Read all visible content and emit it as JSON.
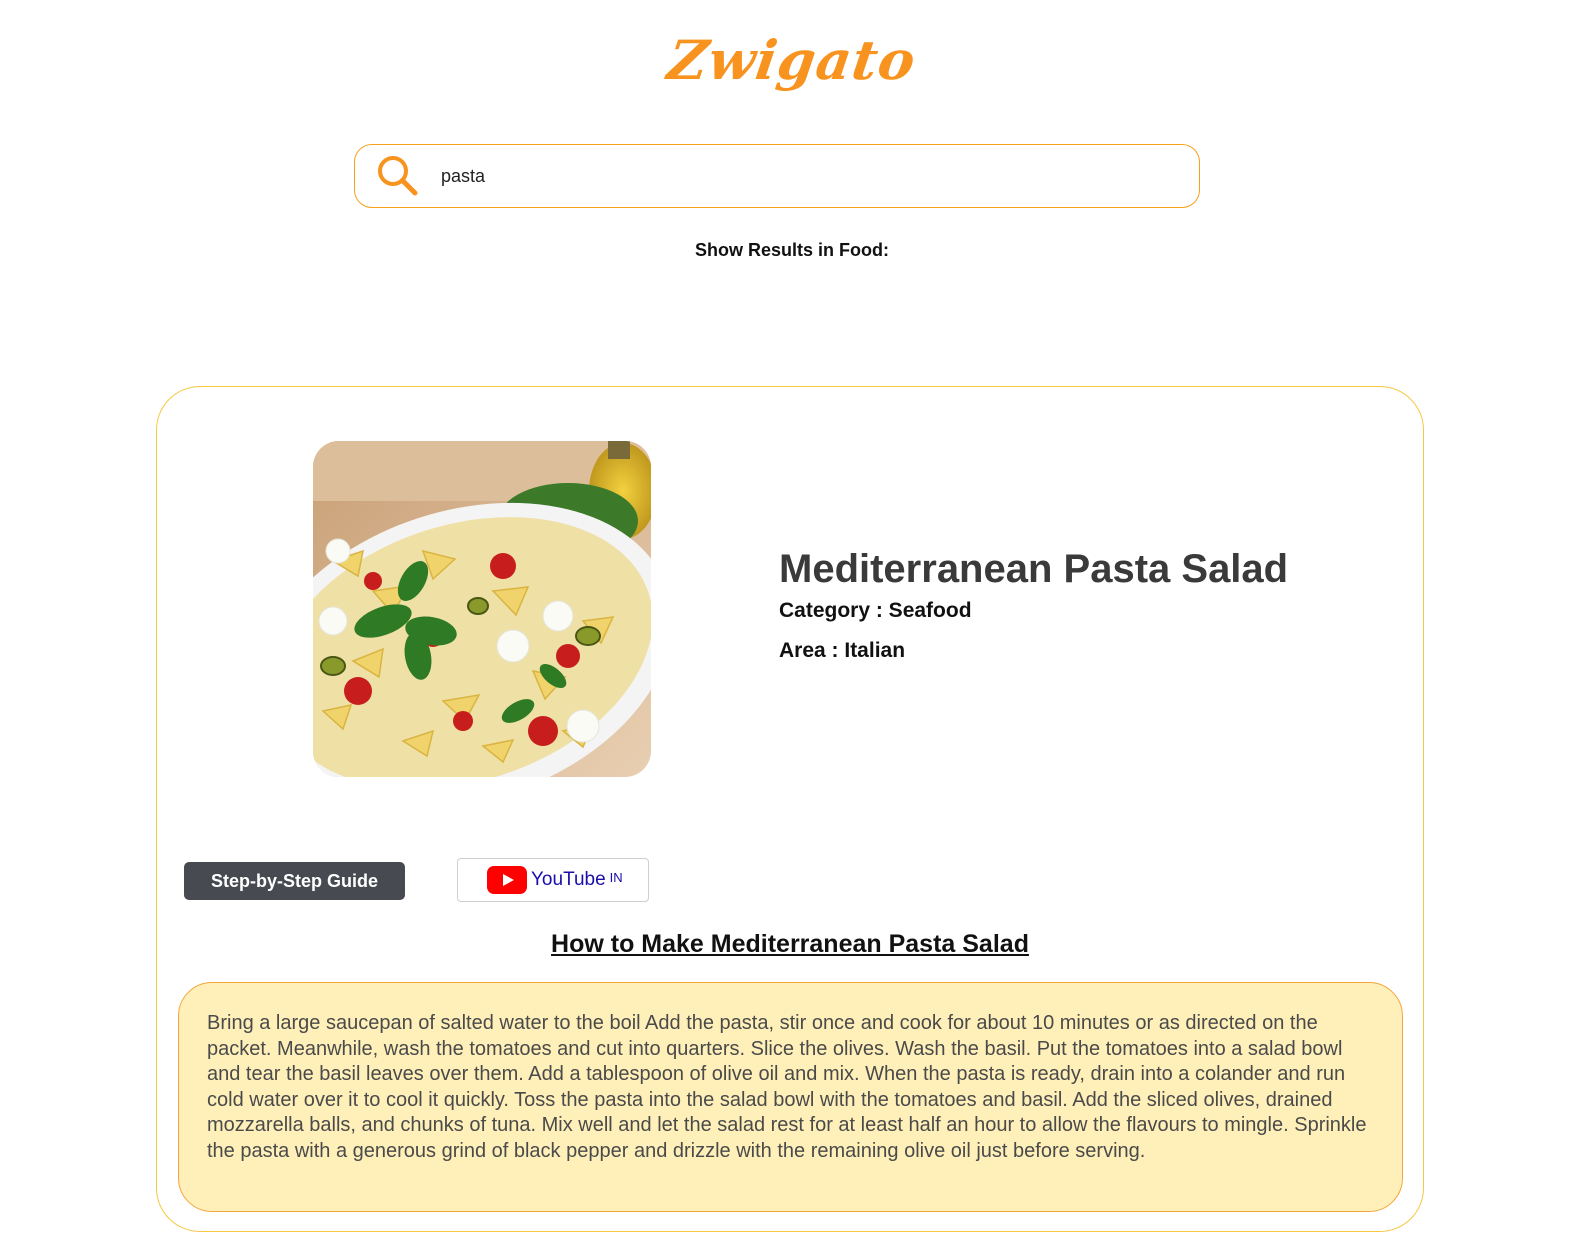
{
  "app": {
    "logo_text": "Zwigato"
  },
  "search": {
    "value": "pasta",
    "placeholder": ""
  },
  "filter": {
    "label": "Show Results in Food:"
  },
  "meal": {
    "name": "Mediterranean Pasta Salad",
    "category_line": "Category : Seafood",
    "area_line": "Area : Italian",
    "image_alt": "pasta-salad-photo"
  },
  "actions": {
    "guide_label": "Step-by-Step Guide",
    "youtube_label": "YouTube",
    "youtube_region": "IN"
  },
  "recipe": {
    "title": "How to Make Mediterranean Pasta Salad",
    "instructions": "Bring a large saucepan of salted water to the boil Add the pasta, stir once and cook for about 10 minutes or as directed on the packet. Meanwhile, wash the tomatoes and cut into quarters. Slice the olives. Wash the basil. Put the tomatoes into a salad bowl and tear the basil leaves over them. Add a tablespoon of olive oil and mix. When the pasta is ready, drain into a colander and run cold water over it to cool it quickly. Toss the pasta into the salad bowl with the tomatoes and basil. Add the sliced olives, drained mozzarella balls, and chunks of tuna. Mix well and let the salad rest for at least half an hour to allow the flavours to mingle. Sprinkle the pasta with a generous grind of black pepper and drizzle with the remaining olive oil just before serving."
  },
  "colors": {
    "brand_orange": "#f7931e",
    "card_border": "#f5c842",
    "instructions_bg": "#fff0ba",
    "guide_button_bg": "#474a51",
    "youtube_red": "#ff0000"
  },
  "icons": {
    "search": "search-icon",
    "youtube": "youtube-play-icon"
  }
}
